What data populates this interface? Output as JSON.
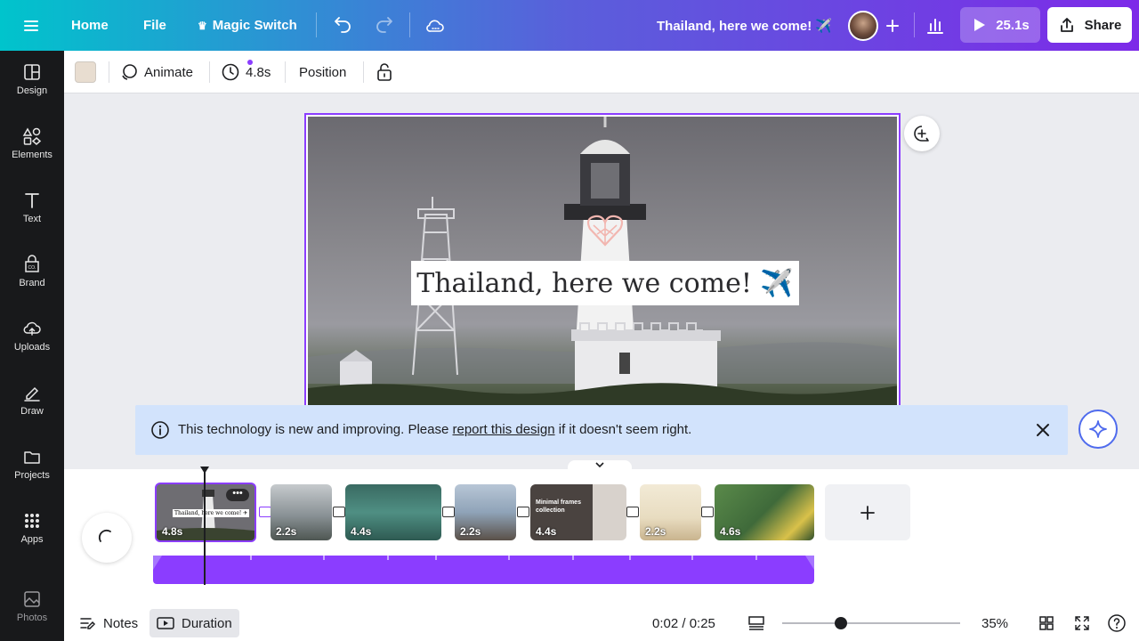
{
  "topbar": {
    "home": "Home",
    "file": "File",
    "magic_switch": "Magic Switch",
    "design_title": "Thailand, here we come! ✈️",
    "play_duration": "25.1s",
    "share": "Share"
  },
  "sidebar": {
    "items": [
      {
        "label": "Design",
        "icon": "design-icon"
      },
      {
        "label": "Elements",
        "icon": "elements-icon"
      },
      {
        "label": "Text",
        "icon": "text-icon"
      },
      {
        "label": "Brand",
        "icon": "brand-icon"
      },
      {
        "label": "Uploads",
        "icon": "uploads-icon"
      },
      {
        "label": "Draw",
        "icon": "draw-icon"
      },
      {
        "label": "Projects",
        "icon": "projects-icon"
      },
      {
        "label": "Apps",
        "icon": "apps-icon"
      },
      {
        "label": "Photos",
        "icon": "photos-icon"
      }
    ]
  },
  "toolbar": {
    "color_swatch": "#e8ddd0",
    "animate": "Animate",
    "duration": "4.8s",
    "position": "Position"
  },
  "canvas": {
    "headline": "Thailand, here we come! ✈️"
  },
  "banner": {
    "text_before": "This technology is new and improving. Please ",
    "link": "report this design",
    "text_after": " if it doesn't seem right."
  },
  "timeline": {
    "clips": [
      {
        "duration": "4.8s",
        "color": "#6e6d72",
        "caption": "Thailand, here we come! ✈"
      },
      {
        "duration": "2.2s",
        "color": "#8a9296",
        "caption": ""
      },
      {
        "duration": "4.4s",
        "color": "#3f7b72",
        "caption": ""
      },
      {
        "duration": "2.2s",
        "color": "#8fa3b8",
        "caption": ""
      },
      {
        "duration": "4.4s",
        "color": "#d8d2cc",
        "caption": "Minimal frames collection"
      },
      {
        "duration": "2.2s",
        "color": "#e8dcc0",
        "caption": ""
      },
      {
        "duration": "4.6s",
        "color": "#3f6a3a",
        "caption": ""
      }
    ]
  },
  "bottombar": {
    "notes": "Notes",
    "duration": "Duration",
    "time": "0:02 / 0:25",
    "zoom": "35%",
    "zoom_level": 0.35
  },
  "colors": {
    "accent": "#8b3dff",
    "banner_bg": "#d2e3fc",
    "sidebar_bg": "#18191b"
  }
}
